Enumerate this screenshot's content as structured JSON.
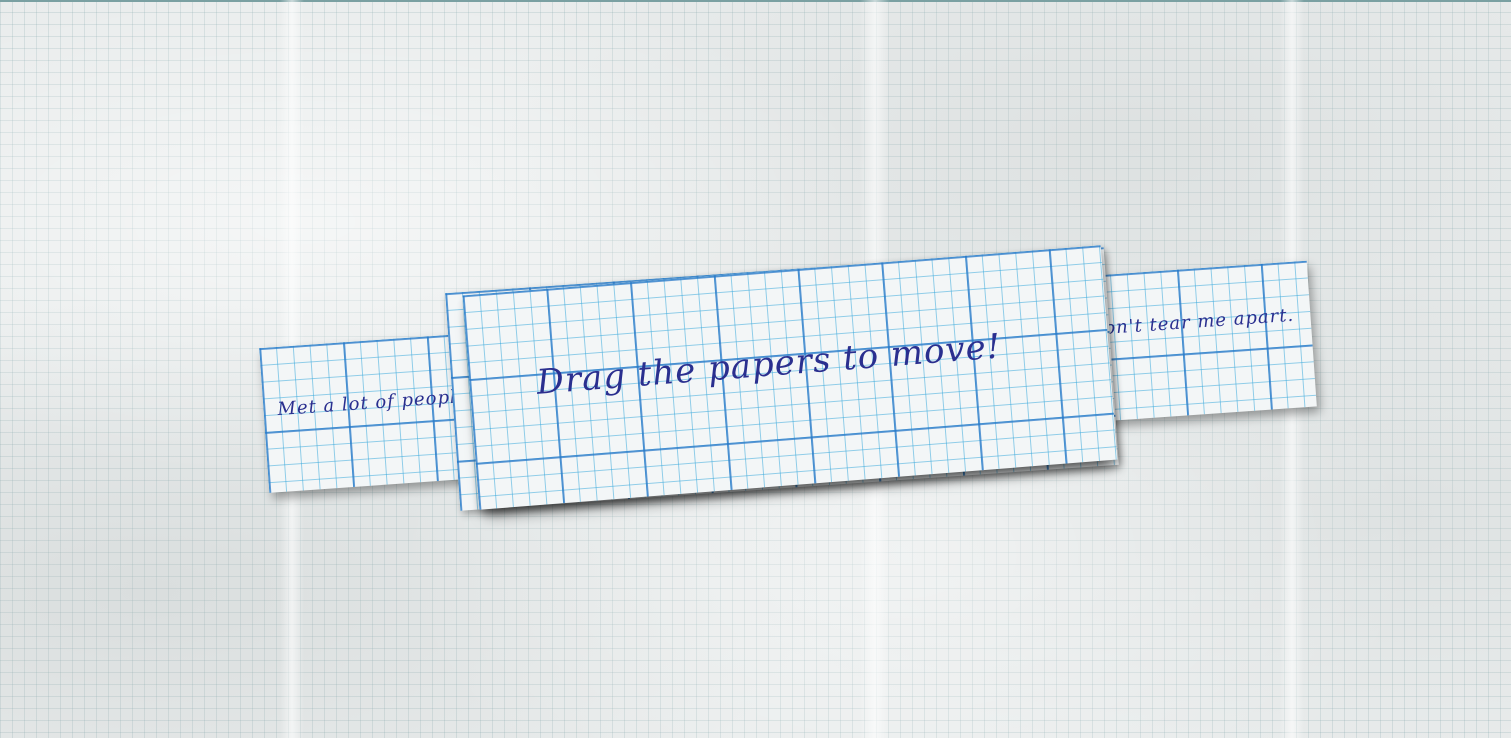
{
  "notes": {
    "left": "Met a lot of people",
    "main": "Drag the papers to move!",
    "right": "Don't tear me apart."
  },
  "colors": {
    "background": "#e9ecec",
    "paper": "#f3f6f7",
    "grid_line": "#3c9ad0",
    "ink": "#2a2f8f"
  }
}
